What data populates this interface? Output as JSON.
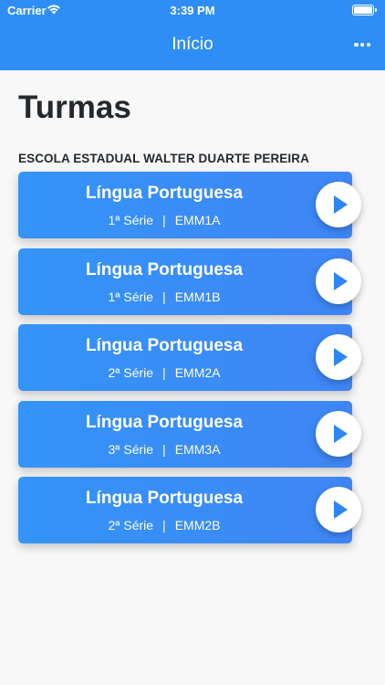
{
  "status_bar": {
    "carrier": "Carrier",
    "time": "3:39 PM"
  },
  "header": {
    "title": "Início",
    "menu_icon": "more-horizontal-icon"
  },
  "page": {
    "title": "Turmas",
    "school": "ESCOLA ESTADUAL WALTER DUARTE PEREIRA"
  },
  "classes": [
    {
      "subject": "Língua Portuguesa",
      "grade": "1ª Série",
      "separator": "|",
      "code": "EMM1A"
    },
    {
      "subject": "Língua Portuguesa",
      "grade": "1ª Série",
      "separator": "|",
      "code": "EMM1B"
    },
    {
      "subject": "Língua Portuguesa",
      "grade": "2ª Série",
      "separator": "|",
      "code": "EMM2A"
    },
    {
      "subject": "Língua Portuguesa",
      "grade": "3ª Série",
      "separator": "|",
      "code": "EMM3A"
    },
    {
      "subject": "Língua Portuguesa",
      "grade": "2ª Série",
      "separator": "|",
      "code": "EMM2B"
    }
  ],
  "colors": {
    "accent": "#2f8ef5",
    "card_start": "#3494f7",
    "card_end": "#3f86f5",
    "text_dark": "#24292d"
  }
}
